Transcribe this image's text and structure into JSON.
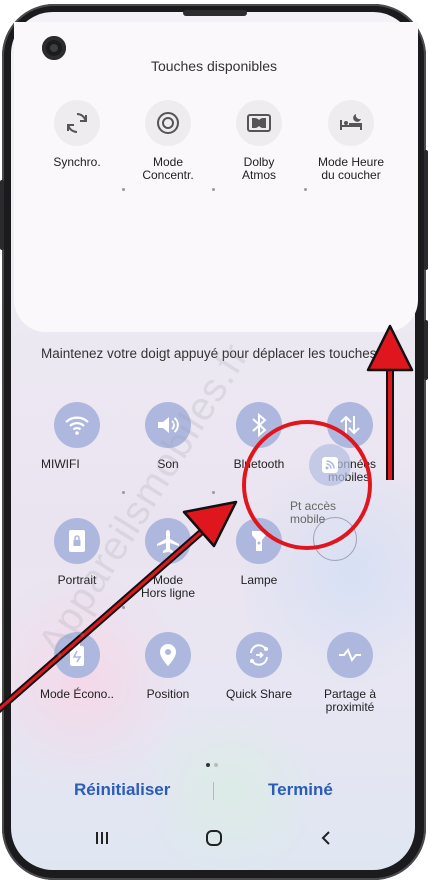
{
  "panel": {
    "title": "Touches disponibles",
    "available": [
      {
        "label": "Synchro.",
        "icon": "sync-icon"
      },
      {
        "label": "Mode\nConcentr.",
        "icon": "focus-mode-icon"
      },
      {
        "label": "Dolby\nAtmos",
        "icon": "dolby-icon"
      },
      {
        "label": "Mode Heure\ndu coucher",
        "icon": "bedtime-icon"
      }
    ]
  },
  "instruction": "Maintenez votre doigt appuyé pour déplacer les touches",
  "tiles": [
    {
      "label": "MIWIFI",
      "icon": "wifi-icon"
    },
    {
      "label": "Son",
      "icon": "sound-icon"
    },
    {
      "label": "Bluetooth",
      "icon": "bluetooth-icon"
    },
    {
      "label": "Données\nmobiles",
      "icon": "mobile-data-icon"
    },
    {
      "label": "Portrait",
      "icon": "portrait-lock-icon"
    },
    {
      "label": "Mode\nHors ligne",
      "icon": "airplane-icon"
    },
    {
      "label": "Lampe",
      "icon": "flashlight-icon"
    },
    {
      "label": "Mode Écono..",
      "icon": "power-saving-icon"
    },
    {
      "label": "Position",
      "icon": "location-icon"
    },
    {
      "label": "Quick Share",
      "icon": "quick-share-icon"
    },
    {
      "label": "Partage à\nproximité",
      "icon": "nearby-share-icon"
    }
  ],
  "dragged_tile": {
    "label": "Pt accès\nmobile",
    "icon": "hotspot-icon"
  },
  "buttons": {
    "reset": "Réinitialiser",
    "done": "Terminé"
  },
  "watermark": "Appareilsmobiles.fr",
  "colors": {
    "accent": "#2b5cb8",
    "tile": "#aeb8df",
    "annotation": "#e0161e"
  }
}
